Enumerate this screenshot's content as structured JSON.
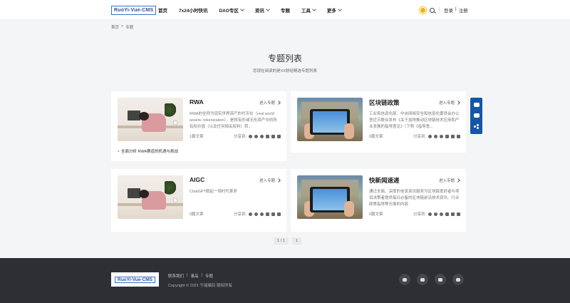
{
  "header": {
    "logo_text": "RuoYi-Vue-CMS",
    "nav": [
      {
        "label": "首页",
        "dropdown": false
      },
      {
        "label": "7x24小时快讯",
        "dropdown": false
      },
      {
        "label": "DAO专区",
        "dropdown": true
      },
      {
        "label": "资讯",
        "dropdown": true
      },
      {
        "label": "专题",
        "dropdown": false
      },
      {
        "label": "工具",
        "dropdown": true
      },
      {
        "label": "更多",
        "dropdown": true
      }
    ],
    "login": "登录",
    "auth_sep": "|",
    "register": "注册"
  },
  "breadcrumb": {
    "home": "首页",
    "sep": ">",
    "current": "专题"
  },
  "page": {
    "title": "专题列表",
    "subtitle": "您现在阅读的是XX财经精选专题列表"
  },
  "cards": [
    {
      "title": "RWA",
      "enter": "进入专题",
      "desc": "RWA的全称为现实世界资产的代币化（real world assets- tokenization），是将有形或无形资产中的所有权价值（以及任何相关权利）转...",
      "count": "1篇文章",
      "share_label": "分享到:",
      "article": "全面分析 RWA赛道的机遇与挑战"
    },
    {
      "title": "区块链政策",
      "enter": "进入专题",
      "desc": "工业和信息化部、中央网络安全和信息化委员会办公室近日联合发布《关于加快推动区块链技术应用和产业发展的指导意见》（下称《指导意...",
      "count": "0篇文章",
      "share_label": "分享到:"
    },
    {
      "title": "AIGC",
      "enter": "进入专题",
      "desc": "ChatGPT掀起一场时代革命",
      "count": "0篇文章",
      "share_label": "分享到:"
    },
    {
      "title": "快新闻速递",
      "enter": "进入专题",
      "desc": "通过全面、深度的信息资讯服务为区块链爱好者与项目决策者提供每日必备的区块链前沿技术资讯、行业政策指导等方面的内容",
      "count": "0篇文章",
      "share_label": "分享到:"
    }
  ],
  "pagination": {
    "info": "1 / 1",
    "page": "1"
  },
  "footer": {
    "logo_text": "RuoYi-Vue-CMS",
    "links": [
      "联系我们",
      "|",
      "事品",
      "|",
      "专题"
    ],
    "copyright": "Copyright © 2021 兮瑶编目 版权所有"
  },
  "colors": {
    "accent": "#1457a6",
    "footer_bg": "#2d2f33"
  }
}
